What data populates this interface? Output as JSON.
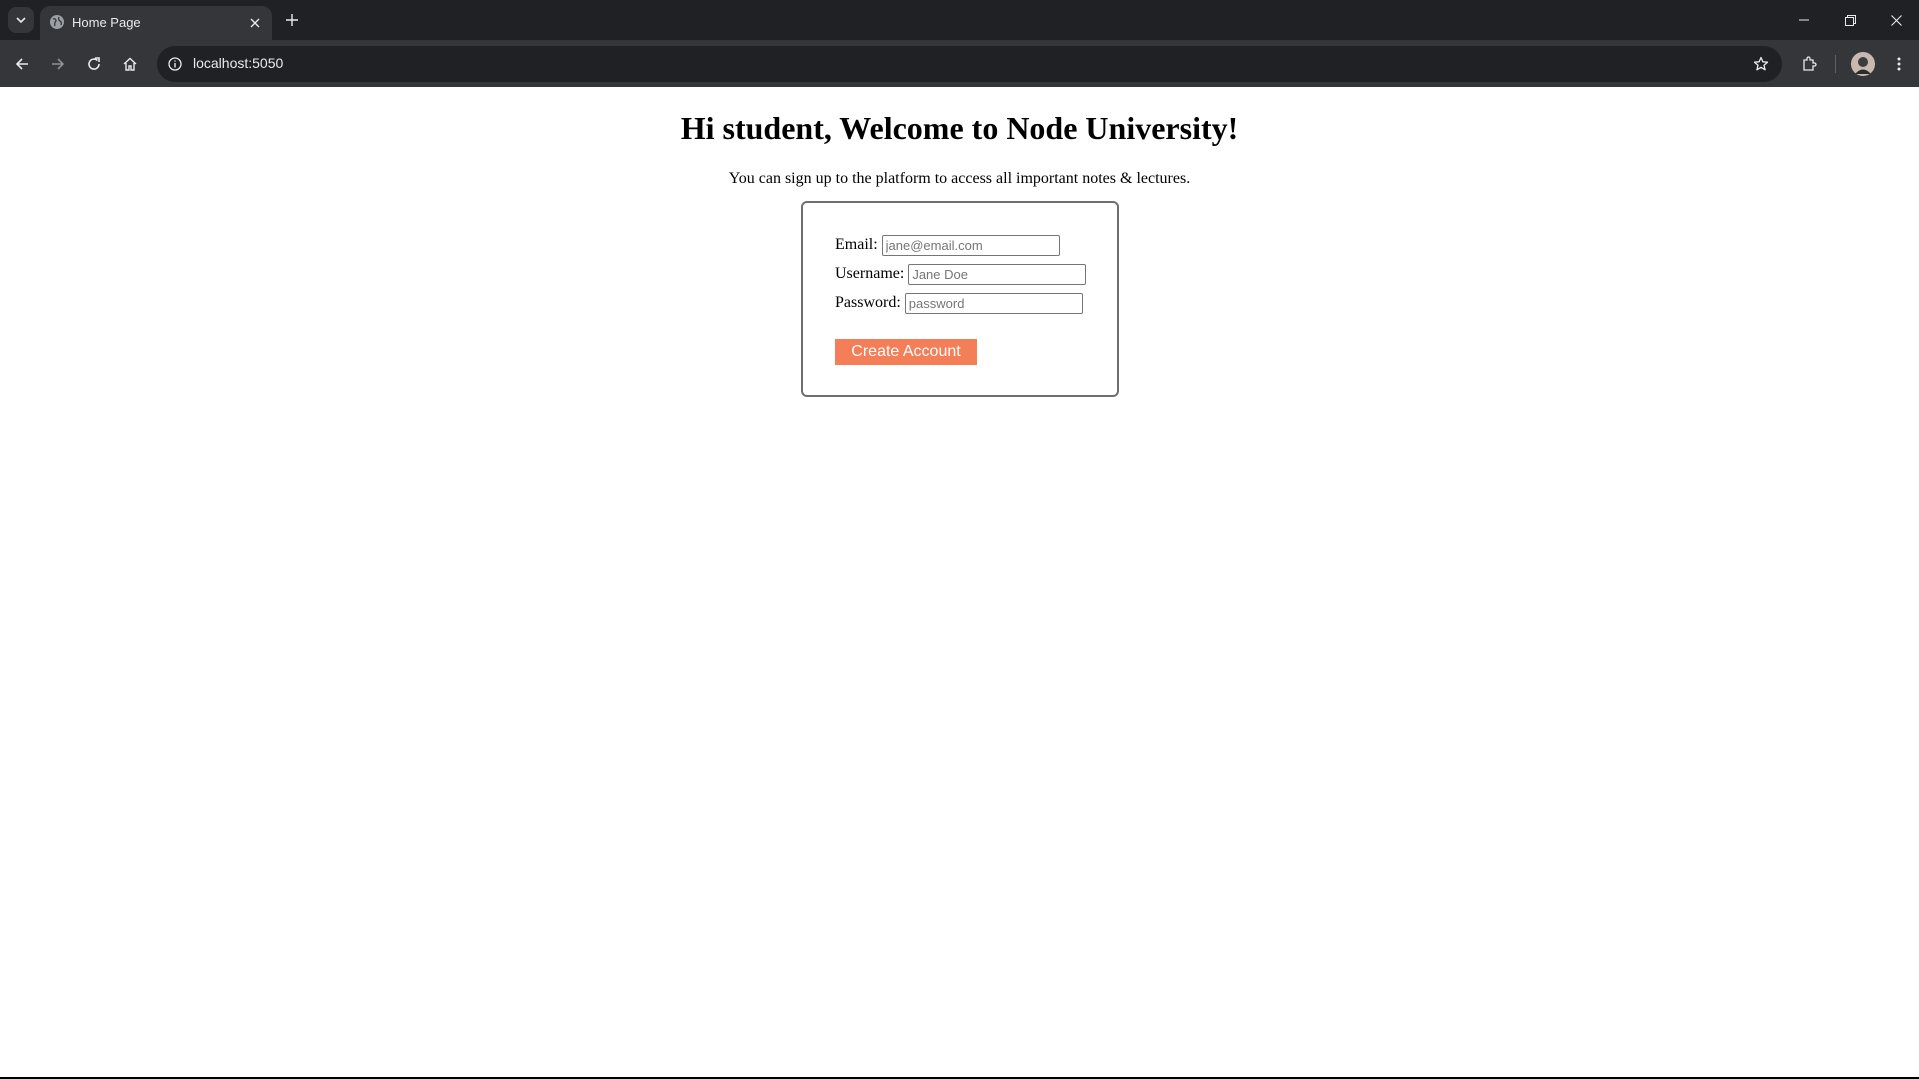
{
  "browser": {
    "tab": {
      "title": "Home Page"
    },
    "address_bar": {
      "url": "localhost:5050"
    }
  },
  "page": {
    "title": "Hi student, Welcome to Node University!",
    "subtitle": "You can sign up to the platform to access all important notes & lectures.",
    "form": {
      "email": {
        "label": "Email:",
        "placeholder": "jane@email.com",
        "value": ""
      },
      "username": {
        "label": "Username:",
        "placeholder": "Jane Doe",
        "value": ""
      },
      "password": {
        "label": "Password:",
        "placeholder": "password",
        "value": ""
      },
      "submit_label": "Create Account"
    }
  },
  "colors": {
    "button_accent": "#f47e57",
    "chrome_dark": "#202124",
    "chrome_toolbar": "#35363a"
  },
  "icons": [
    "tab-list-icon",
    "globe-icon",
    "close-icon",
    "plus-icon",
    "minimize-icon",
    "restore-icon",
    "back-icon",
    "forward-icon",
    "reload-icon",
    "home-icon",
    "info-icon",
    "star-icon",
    "extensions-icon",
    "avatar",
    "more-icon"
  ]
}
